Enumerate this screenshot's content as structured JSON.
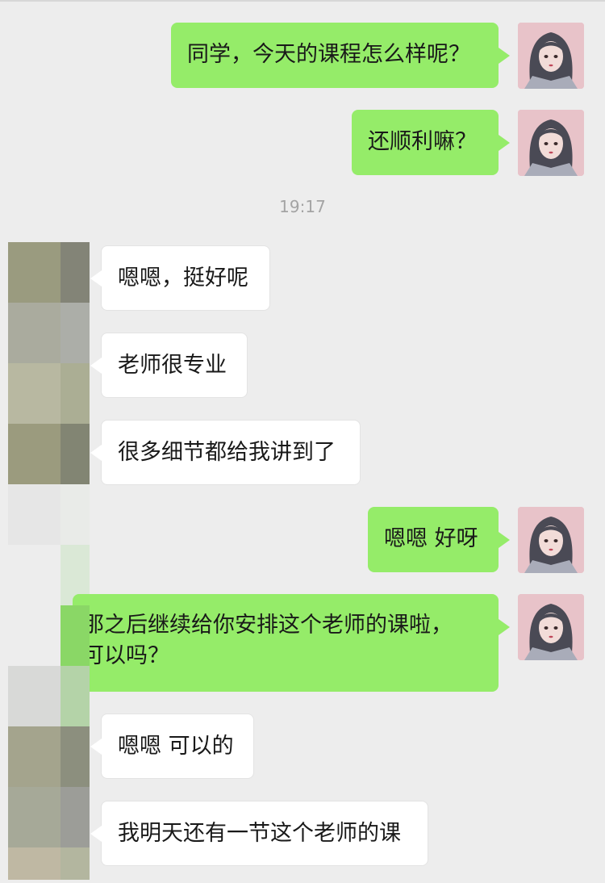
{
  "messages": [
    {
      "side": "sent",
      "text": "同学，今天的课程怎么样呢？"
    },
    {
      "side": "sent",
      "text": "还顺利嘛？"
    },
    {
      "side": "recv",
      "text": "嗯嗯，挺好呢"
    },
    {
      "side": "recv",
      "text": "老师很专业"
    },
    {
      "side": "recv",
      "text": "很多细节都给我讲到了"
    },
    {
      "side": "sent",
      "text": "嗯嗯 好呀"
    },
    {
      "side": "sent",
      "line1": "那之后继续给你安排这个老师的课啦，",
      "line2": "可以吗？"
    },
    {
      "side": "recv",
      "text": "嗯嗯 可以的"
    },
    {
      "side": "recv",
      "text": "我明天还有一节这个老师的课"
    }
  ],
  "timestamp": "19:17",
  "colors": {
    "sent": "#95ec69",
    "received": "#ffffff",
    "background": "#ededed",
    "timestamp": "#a4a4a4"
  },
  "icons": {
    "self_avatar": "avatar-icon",
    "contact_avatar": "pixelated-avatar-icon"
  }
}
